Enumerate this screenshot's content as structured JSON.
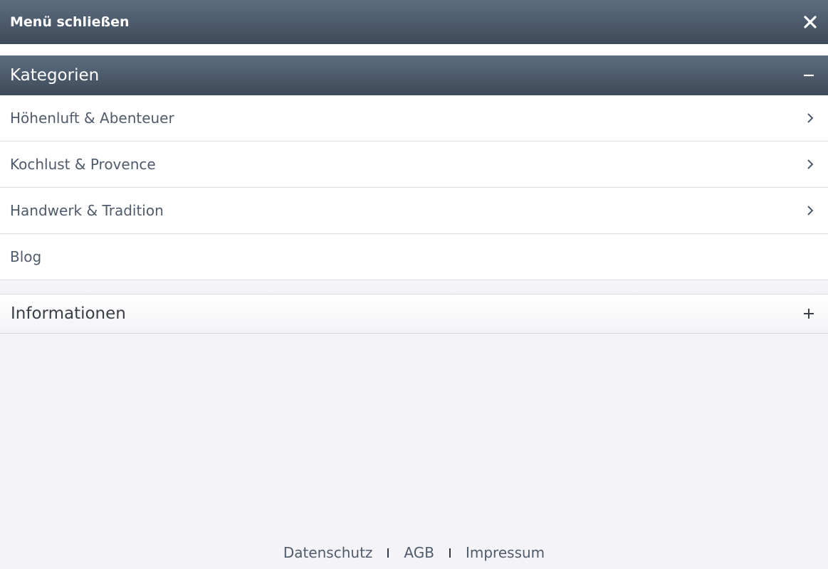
{
  "topbar": {
    "close_label": "Menü schließen",
    "close_icon": "close-icon"
  },
  "sections": {
    "categories": {
      "title": "Kategorien",
      "state_icon": "minus-icon",
      "items": [
        {
          "label": "Höhenluft & Abenteuer",
          "icon": "chevron-right-icon"
        },
        {
          "label": "Kochlust & Provence",
          "icon": "chevron-right-icon"
        },
        {
          "label": "Handwerk & Tradition",
          "icon": "chevron-right-icon"
        },
        {
          "label": "Blog"
        }
      ]
    },
    "information": {
      "title": "Informationen",
      "state_icon": "plus-icon"
    }
  },
  "footer": {
    "links": [
      "Datenschutz",
      "AGB",
      "Impressum"
    ]
  },
  "colors": {
    "header_dark": "#3d4a59",
    "header_light": "#5d6d80",
    "text": "#4f5b6a",
    "background": "#f4f4f8"
  }
}
